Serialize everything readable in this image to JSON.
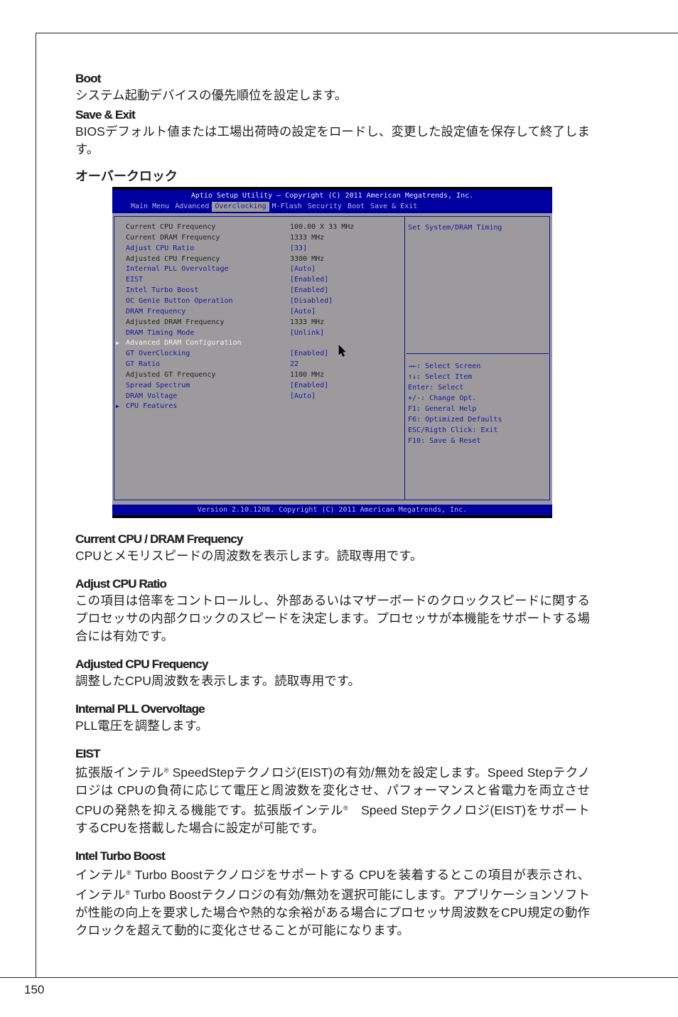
{
  "sections_top": [
    {
      "title": "Boot",
      "body": "システム起動デバイスの優先順位を設定します。"
    },
    {
      "title": "Save & Exit",
      "body": "BIOSデフォルト値または工場出荷時の設定をロードし、変更した設定値を保存して終了します。"
    }
  ],
  "overclock_heading": "オーバークロック",
  "bios": {
    "title": "Aptio Setup Utility – Copyright (C) 2011 American Megatrends, Inc.",
    "tabs": [
      "Main Menu",
      "Advanced",
      "Overclocking",
      "M-Flash",
      "Security",
      "Boot",
      "Save & Exit"
    ],
    "active_tab": "Overclocking",
    "rows": [
      {
        "label": "Current CPU Frequency",
        "value": "100.00 X 33 MHz",
        "style": "static"
      },
      {
        "label": "Current DRAM Frequency",
        "value": "1333 MHz",
        "style": "static"
      },
      {
        "label": "Adjust CPU Ratio",
        "value": "[33]",
        "style": "option"
      },
      {
        "label": "Adjusted CPU Frequency",
        "value": "3300 MHz",
        "style": "static"
      },
      {
        "label": "Internal PLL Overvoltage",
        "value": "[Auto]",
        "style": "option"
      },
      {
        "label": "EIST",
        "value": "[Enabled]",
        "style": "option"
      },
      {
        "label": "Intel Turbo Boost",
        "value": "[Enabled]",
        "style": "option"
      },
      {
        "label": "OC Genie Button Operation",
        "value": "[Disabled]",
        "style": "option"
      },
      {
        "label": "DRAM Frequency",
        "value": "[Auto]",
        "style": "option"
      },
      {
        "label": "Adjusted DRAM Frequency",
        "value": "1333 MHz",
        "style": "static"
      },
      {
        "label": "DRAM Timing Mode",
        "value": "[Unlink]",
        "style": "option"
      },
      {
        "label": "Advanced DRAM Configuration",
        "value": "",
        "style": "submenu-selected"
      },
      {
        "label": "GT OverClocking",
        "value": "[Enabled]",
        "style": "option"
      },
      {
        "label": "GT Ratio",
        "value": "22",
        "style": "option"
      },
      {
        "label": "Adjusted GT Frequency",
        "value": "1100 MHz",
        "style": "static"
      },
      {
        "label": "Spread Spectrum",
        "value": "[Enabled]",
        "style": "option"
      },
      {
        "label": "DRAM Voltage",
        "value": "[Auto]",
        "style": "option"
      },
      {
        "label": "CPU Features",
        "value": "",
        "style": "submenu"
      }
    ],
    "help_text": "Set System/DRAM Timing",
    "keys": [
      "→←: Select Screen",
      "↑↓: Select Item",
      "Enter: Select",
      "+/-: Change Opt.",
      "F1: General Help",
      "F6: Optimized Defaults",
      "ESC/Rigth Click: Exit",
      "F10: Save & Reset"
    ],
    "footer": "Version 2.10.1208. Copyright (C) 2011 American Megatrends, Inc.",
    "colors": {
      "header_blue": "#0000a0",
      "body_gray": "#9c9a9c",
      "option_blue": "#1818a0"
    }
  },
  "sections_bottom": [
    {
      "title": "Current CPU / DRAM Frequency",
      "body": "CPUとメモリスピードの周波数を表示します。読取専用です。"
    },
    {
      "title": "Adjust CPU Ratio",
      "body": "この項目は倍率をコントロールし、外部あるいはマザーボードのクロックスピードに関するプロセッサの内部クロックのスピードを決定します。プロセッサが本機能をサポートする場合には有効です。"
    },
    {
      "title": "Adjusted CPU Frequency",
      "body": "調整したCPU周波数を表示します。読取専用です。"
    },
    {
      "title": "Internal PLL Overvoltage",
      "body": "PLL電圧を調整します。"
    },
    {
      "title": "EIST",
      "body": "拡張版インテル® SpeedStepテクノロジ(EIST)の有効/無効を設定します。Speed Stepテクノロジは CPUの負荷に応じて電圧と周波数を変化させ、パフォーマンスと省電力を両立させCPUの発熱を抑える機能です。拡張版インテル®　Speed Stepテクノロジ(EIST)をサポートするCPUを搭載した場合に設定が可能です。"
    },
    {
      "title": "Intel Turbo Boost",
      "body": "インテル® Turbo Boostテクノロジをサポートする CPUを装着するとこの項目が表示され、インテル® Turbo Boostテクノロジの有効/無効を選択可能にします。アプリケーションソフトが性能の向上を要求した場合や熱的な余裕がある場合にプロセッサ周波数をCPU規定の動作クロックを超えて動的に変化させることが可能になります。"
    }
  ],
  "page_number": "150"
}
